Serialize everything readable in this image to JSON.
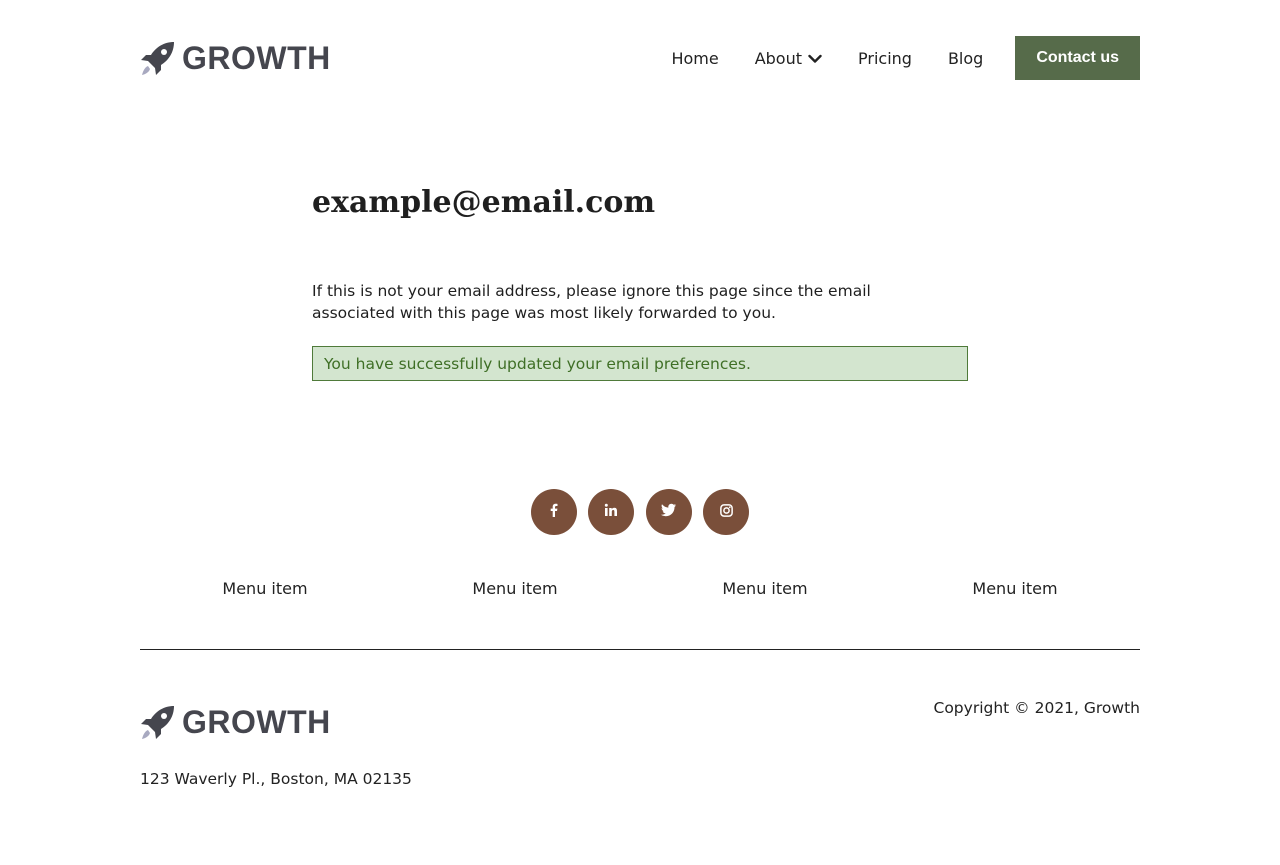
{
  "header": {
    "logo_text": "GROWTH",
    "nav": {
      "home": "Home",
      "about": "About",
      "pricing": "Pricing",
      "blog": "Blog"
    },
    "contact_label": "Contact us"
  },
  "main": {
    "email": "example@email.com",
    "note": "If this is not your email address, please ignore this page since the email associated with this page was most likely forwarded to you.",
    "success_message": "You have successfully updated your email preferences."
  },
  "social": {
    "icons": [
      "facebook-icon",
      "linkedin-icon",
      "twitter-icon",
      "instagram-icon"
    ]
  },
  "footer": {
    "menu_items": [
      "Menu item",
      "Menu item",
      "Menu item",
      "Menu item"
    ],
    "logo_text": "GROWTH",
    "copyright": "Copyright © 2021, Growth",
    "address": "123 Waverly Pl., Boston, MA 02135"
  },
  "colors": {
    "accent": "#566b4a",
    "social": "#7a4f3a",
    "success_bg": "#d3e5cf",
    "success_text": "#3f6f26",
    "logo": "#45464e"
  }
}
